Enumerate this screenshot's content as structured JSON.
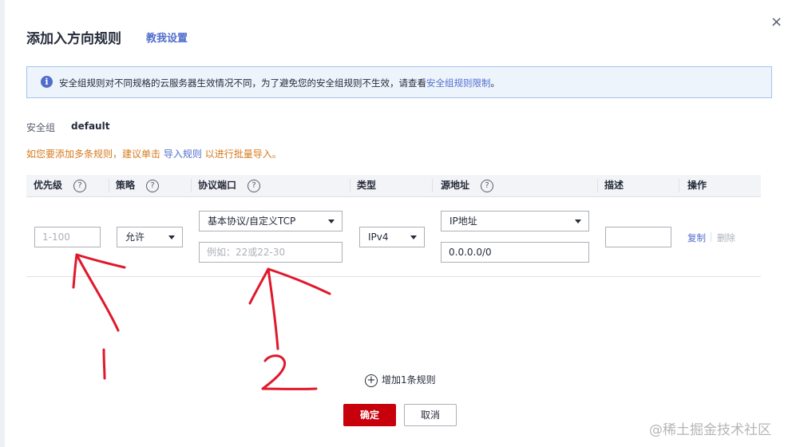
{
  "dialog": {
    "title": "添加入方向规则",
    "help_link": "教我设置",
    "close_glyph": "×"
  },
  "notice": {
    "icon": "info-icon",
    "icon_glyph": "i",
    "text": "安全组规则对不同规格的云服务器生效情况不同，为了避免您的安全组规则不生效，请查看",
    "link": "安全组规则限制",
    "suffix": "。"
  },
  "security_group": {
    "label": "安全组",
    "value": "default"
  },
  "tip": {
    "prefix": "如您要添加多条规则，建议单击",
    "link": "导入规则",
    "suffix": "以进行批量导入。"
  },
  "table": {
    "headers": [
      {
        "label": "优先级",
        "help": "?"
      },
      {
        "label": "策略",
        "help": "?"
      },
      {
        "label": "协议端口",
        "help": "?"
      },
      {
        "label": "类型"
      },
      {
        "label": "源地址",
        "help": "?"
      },
      {
        "label": "描述"
      },
      {
        "label": "操作"
      }
    ],
    "row": {
      "priority_placeholder": "1-100",
      "policy": "允许",
      "protocol": "基本协议/自定义TCP",
      "port_placeholder": "例如：22或22-30",
      "type": "IPv4",
      "source_type": "IP地址",
      "source_value": "0.0.0.0/0",
      "description": "",
      "copy": "复制",
      "delete": "删除"
    }
  },
  "add_rule": {
    "icon": "plus-circle-icon",
    "icon_glyph": "+",
    "label": "增加1条规则"
  },
  "buttons": {
    "ok": "确定",
    "cancel": "取消"
  },
  "watermark": "@稀土掘金技术社区",
  "annotations": {
    "color": "#e0182b",
    "labels": [
      "1",
      "2"
    ]
  },
  "colors": {
    "brand_red": "#c7000b",
    "link_blue": "#526ecc",
    "tip_orange": "#d67a1d",
    "notice_bg": "#edf4fc"
  }
}
